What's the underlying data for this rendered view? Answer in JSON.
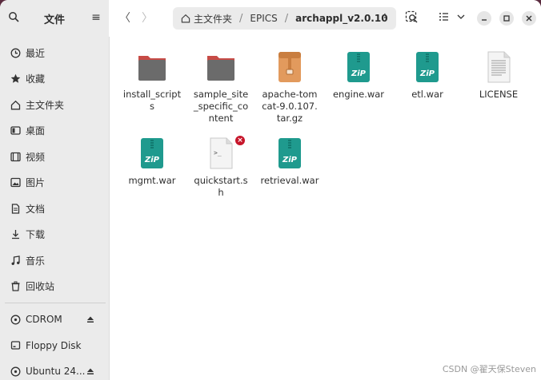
{
  "sidebar": {
    "title": "文件",
    "places": [
      {
        "label": "最近",
        "icon": "clock-icon"
      },
      {
        "label": "收藏",
        "icon": "star-icon"
      },
      {
        "label": "主文件夹",
        "icon": "home-icon"
      },
      {
        "label": "桌面",
        "icon": "desktop-icon"
      },
      {
        "label": "视频",
        "icon": "video-icon"
      },
      {
        "label": "图片",
        "icon": "picture-icon"
      },
      {
        "label": "文档",
        "icon": "document-icon"
      },
      {
        "label": "下载",
        "icon": "download-icon"
      },
      {
        "label": "音乐",
        "icon": "music-icon"
      },
      {
        "label": "回收站",
        "icon": "trash-icon"
      }
    ],
    "devices": [
      {
        "label": "CDROM",
        "icon": "disc-icon",
        "eject": true
      },
      {
        "label": "Floppy Disk",
        "icon": "drive-icon",
        "eject": false
      },
      {
        "label": "Ubuntu 24...",
        "icon": "disc-icon",
        "eject": true
      }
    ]
  },
  "header": {
    "path": [
      {
        "label": "主文件夹",
        "icon": "home-icon"
      },
      {
        "label": "EPICS"
      },
      {
        "label": "archappl_v2.0.10",
        "current": true
      }
    ]
  },
  "files": [
    {
      "name": "install_scripts",
      "type": "folder"
    },
    {
      "name": "sample_site_specific_content",
      "type": "folder"
    },
    {
      "name": "apache-tomcat-9.0.107.tar.gz",
      "type": "archive"
    },
    {
      "name": "engine.war",
      "type": "zip"
    },
    {
      "name": "etl.war",
      "type": "zip"
    },
    {
      "name": "LICENSE",
      "type": "text"
    },
    {
      "name": "mgmt.war",
      "type": "zip"
    },
    {
      "name": "quickstart.sh",
      "type": "script",
      "badge": true
    },
    {
      "name": "retrieval.war",
      "type": "zip"
    }
  ],
  "zip_label": "ZiP",
  "script_glyph": ">_",
  "badge_glyph": "×",
  "watermark": "CSDN @翟天保Steven",
  "colors": {
    "folder": "#6b6b6b",
    "folder_tab": "#b5413f",
    "zip": "#1f9a8e",
    "archive": "#e29a5d",
    "badge": "#c7162b"
  }
}
